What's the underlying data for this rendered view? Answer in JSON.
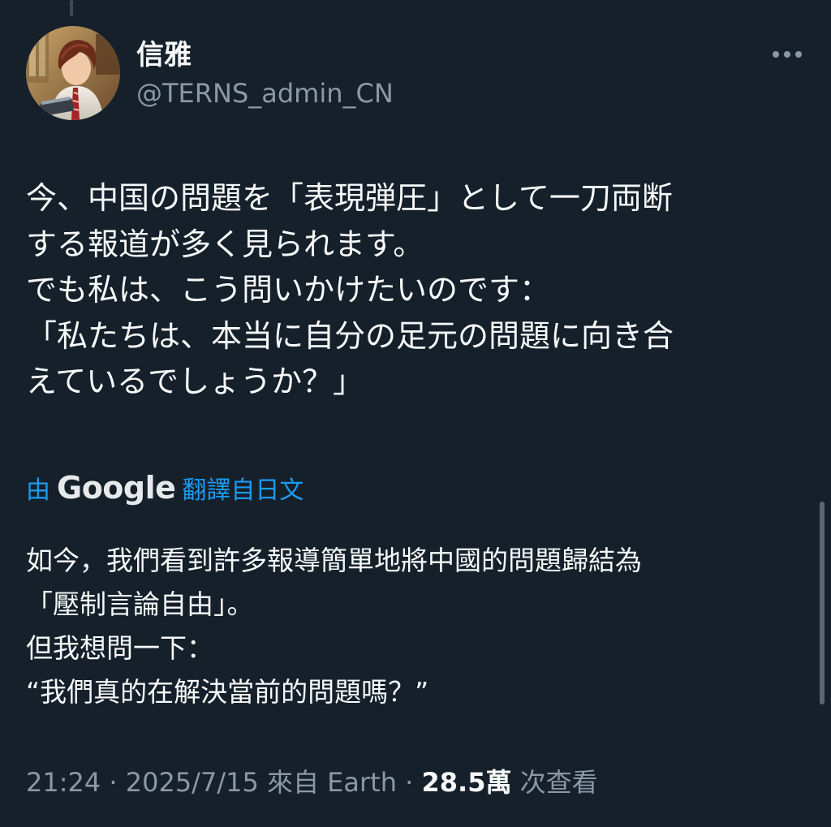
{
  "author": {
    "display_name": "信雅",
    "handle": "@TERNS_admin_CN"
  },
  "tweet": {
    "text": "今、中国の問題を「表現弾圧」として一刀両断\nする報道が多く見られます。\nでも私は、こう問いかけたいのです：\n「私たちは、本当に自分の足元の問題に向き合\nえているでしょうか？」"
  },
  "translation": {
    "prefix": "由",
    "provider": "Google",
    "suffix": "翻譯自日文",
    "text": "如今，我們看到許多報導簡單地將中國的問題歸結為\n「壓制言論自由」。\n但我想問一下：\n“我們真的在解決當前的問題嗎？”"
  },
  "meta": {
    "time": "21:24",
    "date": "2025/7/15",
    "source": "來自 Earth",
    "separator": " · ",
    "views_count": "28.5萬",
    "views_label": "次查看"
  },
  "icons": {
    "more": "more-horizontal-icon",
    "avatar": "avatar-illustration"
  },
  "colors": {
    "background": "#15202b",
    "primary_text": "#f7f9f9",
    "secondary_text": "#8b98a5",
    "link": "#1d9bf0"
  }
}
